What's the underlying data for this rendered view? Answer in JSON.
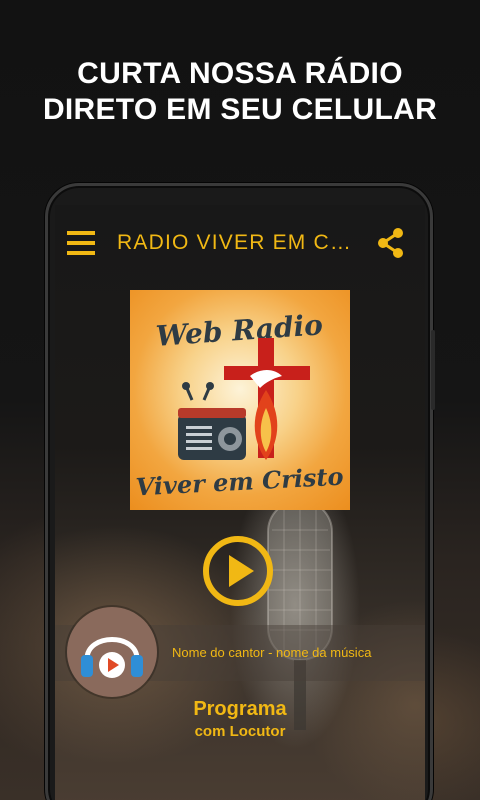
{
  "promo": {
    "line1": "CURTA NOSSA RÁDIO",
    "line2": "DIRETO EM SEU CELULAR"
  },
  "appbar": {
    "title": "RADIO VIVER EM CRIS...",
    "menu_icon": "hamburger-menu-icon",
    "share_icon": "share-icon"
  },
  "logo": {
    "line1": "Web Radio",
    "line2": "Viver em Cristo"
  },
  "player": {
    "play_icon": "play-icon",
    "now_playing": "Nome do cantor - nome da música",
    "program": "Programa",
    "host": "com Locutor",
    "avatar_icon": "headphones-icon"
  },
  "colors": {
    "accent": "#f1b814",
    "background": "#141414",
    "avatar_bg": "#8a6a5c",
    "logo_cross": "#c8201b"
  }
}
